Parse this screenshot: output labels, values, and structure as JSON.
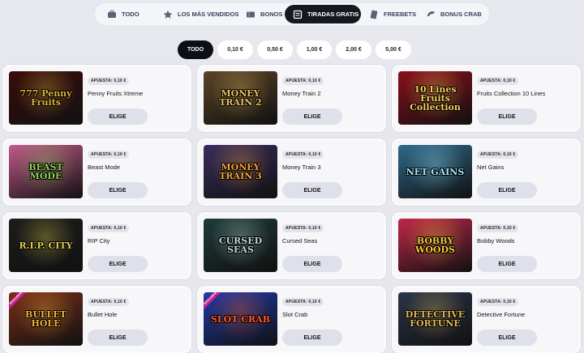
{
  "nav": {
    "tabs": [
      {
        "label": "TODO",
        "icon": "briefcase-icon"
      },
      {
        "label": "LOS MÁS VENDIDOS",
        "icon": "star-icon"
      },
      {
        "label": "BONOS",
        "icon": "ticket-icon"
      },
      {
        "label": "TIRADAS GRATIS",
        "icon": "free-spins-ticket-icon",
        "active": true
      },
      {
        "label": "FREEBETS",
        "icon": "coupon-icon"
      },
      {
        "label": "BONUS CRAB",
        "icon": "crab-claw-icon"
      }
    ]
  },
  "filters": [
    {
      "label": "TODO",
      "active": true
    },
    {
      "label": "0,10 €"
    },
    {
      "label": "0,50 €"
    },
    {
      "label": "1,00 €"
    },
    {
      "label": "2,00 €"
    },
    {
      "label": "5,00 €"
    }
  ],
  "colors": {
    "background": "#e7e8ee",
    "active_tab": "#16181f",
    "button": "#dfe1ea"
  },
  "games": [
    {
      "name": "Penny Fruits Xtreme",
      "bet": "APUESTA: 0,10 €",
      "button": "ELIGE",
      "art_text": "777 Penny Fruits",
      "bg": "#3a0c0c",
      "accent": "#e0b43a"
    },
    {
      "name": "Money Train 2",
      "bet": "APUESTA: 0,10 €",
      "button": "ELIGE",
      "art_text": "MONEY TRAIN 2",
      "bg": "#5a4326",
      "accent": "#e8c064"
    },
    {
      "name": "Fruits Collection 10 Lines",
      "bet": "APUESTA: 0,10 €",
      "button": "ELIGE",
      "art_text": "10 Lines Fruits Collection",
      "bg": "#8a0f1a",
      "accent": "#f6d05a"
    },
    {
      "name": "Beast Mode",
      "bet": "APUESTA: 0,10 €",
      "button": "ELIGE",
      "art_text": "BEAST MODE",
      "bg": "#c15a8a",
      "accent": "#8fd05a"
    },
    {
      "name": "Money Train 3",
      "bet": "APUESTA: 0,10 €",
      "button": "ELIGE",
      "art_text": "MONEY TRAIN 3",
      "bg": "#3a2d5e",
      "accent": "#f0a03a"
    },
    {
      "name": "Net Gains",
      "bet": "APUESTA: 0,10 €",
      "button": "ELIGE",
      "art_text": "NET GAINS",
      "bg": "#2e6a8a",
      "accent": "#9fe6ff"
    },
    {
      "name": "RIP City",
      "bet": "APUESTA: 0,10 €",
      "button": "ELIGE",
      "art_text": "R.I.P. CITY",
      "bg": "#1c1c1c",
      "accent": "#e0d04a"
    },
    {
      "name": "Cursed Seas",
      "bet": "APUESTA: 0,10 €",
      "button": "ELIGE",
      "art_text": "CURSED SEAS",
      "bg": "#1e3a3a",
      "accent": "#bcd7d0"
    },
    {
      "name": "Bobby Woods",
      "bet": "APUESTA: 0,10 €",
      "button": "ELIGE",
      "art_text": "BOBBY WOODS",
      "bg": "#c0264a",
      "accent": "#f7c83a"
    },
    {
      "name": "Bullet Hole",
      "bet": "APUESTA: 0,10 €",
      "button": "ELIGE",
      "art_text": "BULLET HOLE",
      "bg": "#7a2e18",
      "accent": "#f2b23a",
      "new": "EXCLUSIVE"
    },
    {
      "name": "Slot Crab",
      "bet": "APUESTA: 0,10 €",
      "button": "ELIGE",
      "art_text": "SLOT CRAB",
      "bg": "#1e3aa8",
      "accent": "#ff5a2a",
      "new": "EXCLUSIVE"
    },
    {
      "name": "Detective Fortune",
      "bet": "APUESTA: 0,10 €",
      "button": "ELIGE",
      "art_text": "DETECTIVE FORTUNE",
      "bg": "#2a3548",
      "accent": "#e0b85a"
    }
  ]
}
